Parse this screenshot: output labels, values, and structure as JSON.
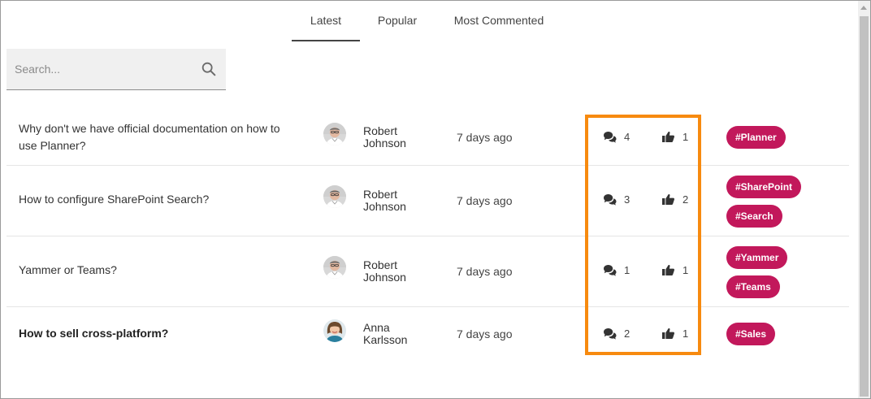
{
  "tabs": [
    {
      "label": "Latest",
      "active": true
    },
    {
      "label": "Popular",
      "active": false
    },
    {
      "label": "Most Commented",
      "active": false
    }
  ],
  "search": {
    "placeholder": "Search...",
    "value": ""
  },
  "questions": [
    {
      "title": "Why don't we have official documentation on how to use Planner?",
      "author_first": "Robert",
      "author_last": "Johnson",
      "time": "7 days ago",
      "comments": "4",
      "likes": "1",
      "tags": [
        "#Planner"
      ],
      "bold": false
    },
    {
      "title": "How to configure SharePoint Search?",
      "author_first": "Robert",
      "author_last": "Johnson",
      "time": "7 days ago",
      "comments": "3",
      "likes": "2",
      "tags": [
        "#SharePoint",
        "#Search"
      ],
      "bold": false
    },
    {
      "title": "Yammer or Teams?",
      "author_first": "Robert",
      "author_last": "Johnson",
      "time": "7 days ago",
      "comments": "1",
      "likes": "1",
      "tags": [
        "#Yammer",
        "#Teams"
      ],
      "bold": false
    },
    {
      "title": "How to sell cross-platform?",
      "author_first": "Anna",
      "author_last": "Karlsson",
      "time": "7 days ago",
      "comments": "2",
      "likes": "1",
      "tags": [
        "#Sales"
      ],
      "bold": true
    }
  ],
  "colors": {
    "tag_bg": "#c2185b",
    "highlight": "#f78a0f"
  },
  "icons": {
    "search": "search-icon",
    "comments": "comments-icon",
    "likes": "thumbs-up-icon"
  }
}
